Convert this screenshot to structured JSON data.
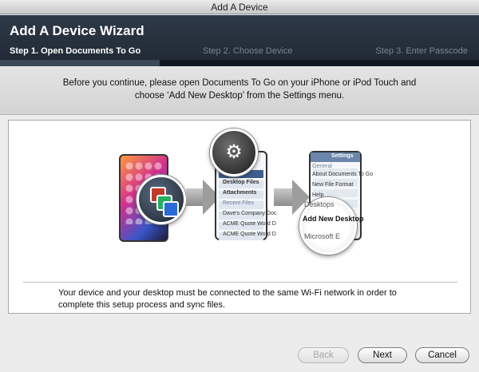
{
  "window": {
    "title": "Add A Device"
  },
  "wizard": {
    "title": "Add A Device Wizard",
    "steps": [
      {
        "label": "Step 1. Open Documents To Go",
        "active": true
      },
      {
        "label": "Step 2. Choose Device",
        "active": false
      },
      {
        "label": "Step 3. Enter Passcode",
        "active": false
      }
    ]
  },
  "instructions": {
    "text": "Before you continue, please open Documents To Go on your iPhone or iPod Touch and choose ‘Add New Desktop’ from the Settings menu."
  },
  "illustration": {
    "docs_screen": {
      "items": [
        "Desktop Files",
        "Attachments",
        "Recent Files",
        "Dave's Company Doc",
        "ACME Quote Word D",
        "ACME Quote Word D"
      ]
    },
    "settings_screen": {
      "header": "Settings",
      "items": [
        "General",
        "About Documents To Go",
        "New File Format",
        "Help"
      ]
    },
    "magnifier": {
      "top": "Desktops",
      "main": "Add New Desktop",
      "bottom": "Microsoft E"
    }
  },
  "footnote": {
    "text": "Your device and your desktop must be connected to the same Wi-Fi network in order to complete this setup process and sync files."
  },
  "buttons": {
    "back": "Back",
    "next": "Next",
    "cancel": "Cancel"
  },
  "colors": {
    "header_bg": "#2a3440",
    "active_step": "#ffffff",
    "inactive_step": "#7a8593"
  }
}
